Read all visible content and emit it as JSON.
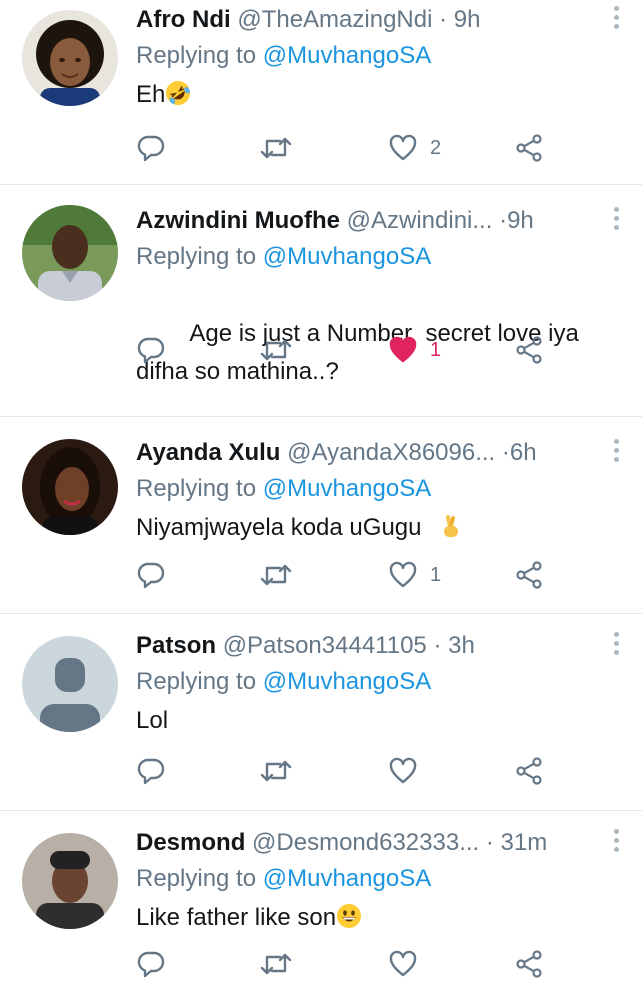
{
  "tweets": [
    {
      "name": "Afro Ndi",
      "handle": "@TheAmazingNdi",
      "sep": "·",
      "time": "9h",
      "reply_prefix": "Replying to",
      "reply_to": "@MuvhangoSA",
      "text": "Eh",
      "emoji": "rolling-on-floor-laughing",
      "like_count": "2",
      "liked": false,
      "avatar_color": "#5a3a2a"
    },
    {
      "name": "Azwindini Muofhe",
      "handle": "@Azwindini...",
      "sep": "·",
      "time": "9h",
      "reply_prefix": "Replying to",
      "reply_to": "@MuvhangoSA",
      "text": "Age is just a Number  secret love iya difha so mathina..?",
      "emoji": "",
      "like_count": "1",
      "liked": true,
      "avatar_color": "#6b8a4a"
    },
    {
      "name": "Ayanda Xulu",
      "handle": "@AyandaX86096...",
      "sep": "·",
      "time": "6h",
      "reply_prefix": "Replying to",
      "reply_to": "@MuvhangoSA",
      "text": "Niyamjwayela koda uGugu",
      "emoji": "crossed-fingers",
      "like_count": "1",
      "liked": false,
      "avatar_color": "#3a2418"
    },
    {
      "name": "Patson",
      "handle": "@Patson34441105",
      "sep": "·",
      "time": "3h",
      "reply_prefix": "Replying to",
      "reply_to": "@MuvhangoSA",
      "text": "Lol",
      "emoji": "",
      "like_count": "",
      "liked": false,
      "avatar_color": "#ccd6dd"
    },
    {
      "name": "Desmond",
      "handle": "@Desmond632333...",
      "sep": "·",
      "time": "31m",
      "reply_prefix": "Replying to",
      "reply_to": "@MuvhangoSA",
      "text": "Like father like son",
      "emoji": "grinning-face",
      "like_count": "",
      "liked": false,
      "avatar_color": "#3b3b3b"
    }
  ],
  "icons": {
    "reply": "reply-icon",
    "retweet": "retweet-icon",
    "like": "heart-icon",
    "share": "share-icon",
    "more": "more-vertical-icon"
  },
  "colors": {
    "accent": "#1b95e0",
    "muted": "#657786",
    "like": "#e0245e"
  }
}
